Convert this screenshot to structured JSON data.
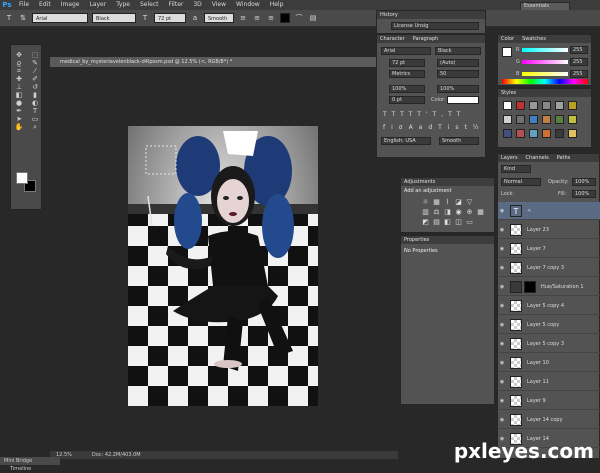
{
  "app": {
    "logo": "Ps"
  },
  "menu": [
    "File",
    "Edit",
    "Image",
    "Layer",
    "Type",
    "Select",
    "Filter",
    "3D",
    "View",
    "Window",
    "Help"
  ],
  "options_bar": {
    "font_family": "Arial",
    "font_style": "Black",
    "font_size": "72 pt",
    "anti_alias": "Smooth",
    "workspace": "Essentials"
  },
  "document": {
    "tab_title": "medical_by_mysteriavelenblack-d4lpssm.psd @ 12.5% (<, RGB/8*) *",
    "zoom": "12.5%",
    "doc_info": "Doc: 42.2M/403.0M"
  },
  "history": {
    "title": "History",
    "item": "License Unsig"
  },
  "character": {
    "tabs": [
      "Character",
      "Paragraph"
    ],
    "font_family": "Arial",
    "font_style": "Black",
    "size": "72 pt",
    "leading": "(Auto)",
    "kerning": "Metrics",
    "tracking": "50",
    "vscale": "100%",
    "hscale": "100%",
    "baseline": "0 pt",
    "color_label": "Color:",
    "language": "English: USA",
    "aa": "Smooth"
  },
  "color_panel": {
    "tabs": [
      "Color",
      "Swatches"
    ],
    "r_label": "R",
    "g_label": "G",
    "b_label": "B",
    "r": "255",
    "g": "255",
    "b": "255"
  },
  "styles_panel": {
    "title": "Styles"
  },
  "adjustments": {
    "title": "Adjustments",
    "subtitle": "Add an adjustment"
  },
  "properties": {
    "title": "Properties",
    "content": "No Properties"
  },
  "layers": {
    "tabs": [
      "Layers",
      "Channels",
      "Paths"
    ],
    "kind": "Kind",
    "blend": "Normal",
    "opacity_label": "Opacity:",
    "opacity": "100%",
    "lock_label": "Lock:",
    "fill_label": "Fill:",
    "fill": "100%",
    "items": [
      {
        "name": "<",
        "type": "text"
      },
      {
        "name": "Layer 23"
      },
      {
        "name": "Layer 7"
      },
      {
        "name": "Layer 7 copy 3"
      },
      {
        "name": "Hue/Saturation 1",
        "type": "adj"
      },
      {
        "name": "Layer 5 copy 4"
      },
      {
        "name": "Layer 5 copy"
      },
      {
        "name": "Layer 5 copy 3"
      },
      {
        "name": "Layer 10"
      },
      {
        "name": "Layer 11"
      },
      {
        "name": "Layer 9"
      },
      {
        "name": "Layer 14 copy"
      },
      {
        "name": "Layer 14"
      }
    ]
  },
  "bottom": {
    "mini_bridge": "Mini Bridge",
    "timeline": "Timeline"
  },
  "watermark": "pxleyes.com"
}
